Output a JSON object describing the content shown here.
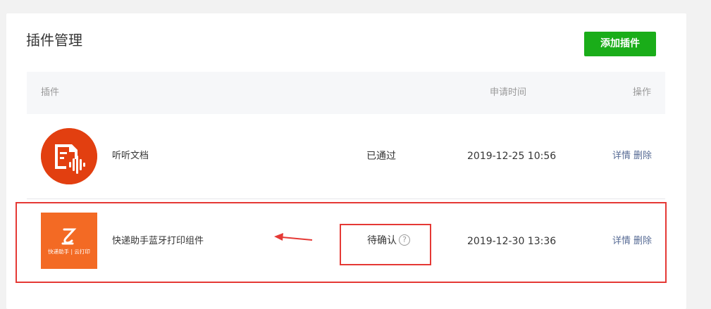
{
  "page": {
    "title": "插件管理",
    "add_button_label": "添加插件"
  },
  "table": {
    "headers": {
      "plugin": "插件",
      "apply_time": "申请时间",
      "actions": "操作"
    },
    "rows": [
      {
        "name": "听听文档",
        "status": "已通过",
        "apply_time": "2019-12-25 10:56",
        "detail_label": "详情",
        "delete_label": "删除",
        "icon": "tingting-doc-logo"
      },
      {
        "name": "快递助手蓝牙打印组件",
        "status": "待确认",
        "apply_time": "2019-12-30 13:36",
        "detail_label": "详情",
        "delete_label": "删除",
        "icon": "kuaidi-helper-logo",
        "logo_caption": "快递助手 | 云打印",
        "help_icon_glyph": "?"
      }
    ]
  },
  "colors": {
    "primary_green": "#1aad19",
    "link_blue": "#576b95",
    "annotation_red": "#e53935",
    "tingting_red": "#e23f10",
    "kuaidi_orange": "#f36a24"
  }
}
